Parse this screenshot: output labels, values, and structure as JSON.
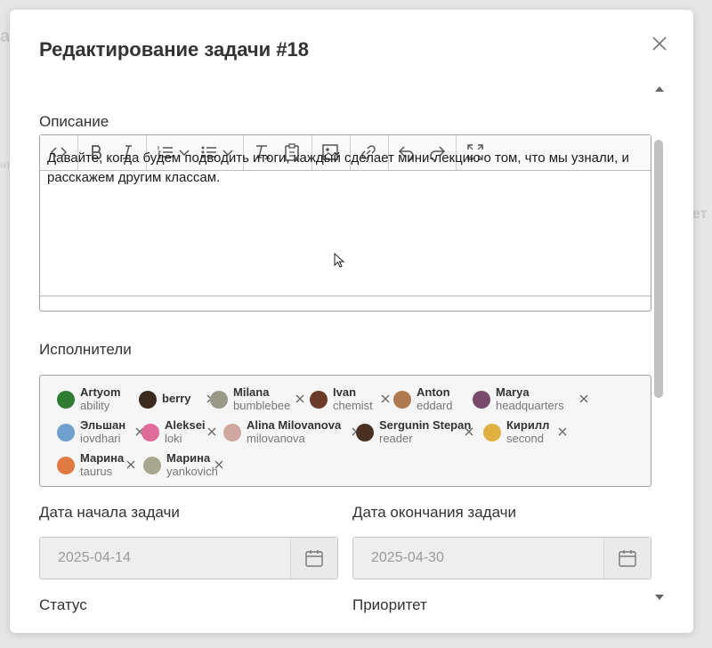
{
  "modal": {
    "title": "Редактирование задачи #18"
  },
  "background": {
    "hint1": "al",
    "hint2": "ет",
    "hint3": "нт"
  },
  "description": {
    "label": "Описание",
    "text": "Давайте, когда будем подводить итоги, каждый сделает мини-лекцию о том, что мы узнали, и расскажем другим классам."
  },
  "toolbar": {
    "icons": [
      "code-icon",
      "bold-icon",
      "italic-icon",
      "ordered-list-icon",
      "bullet-list-icon",
      "clear-format-icon",
      "paste-icon",
      "image-icon",
      "link-icon",
      "undo-icon",
      "redo-icon",
      "fullscreen-icon"
    ]
  },
  "assignees": {
    "label": "Исполнители",
    "items": [
      {
        "name": "Artyom",
        "username": "ability",
        "color": "#2e7d32"
      },
      {
        "name": "berry",
        "username": "",
        "color": "#3a2a20"
      },
      {
        "name": "Milana",
        "username": "bumblebee",
        "color": "#9a9a8a"
      },
      {
        "name": "Ivan",
        "username": "chemist",
        "color": "#6b3b2a"
      },
      {
        "name": "Anton",
        "username": "eddard",
        "color": "#b07a50"
      },
      {
        "name": "Marya",
        "username": "headquarters",
        "color": "#7a4a6a"
      },
      {
        "name": "Эльшан",
        "username": "iovdhari",
        "color": "#6fa0d0"
      },
      {
        "name": "Aleksei",
        "username": "loki",
        "color": "#e06a9a"
      },
      {
        "name": "Alina Milovanova",
        "username": "milovanova",
        "color": "#d0a8a0"
      },
      {
        "name": "Sergunin Stepan",
        "username": "reader",
        "color": "#4a3020"
      },
      {
        "name": "Кирилл",
        "username": "second",
        "color": "#e0b040"
      },
      {
        "name": "Марина",
        "username": "taurus",
        "color": "#e07a40"
      },
      {
        "name": "Марина",
        "username": "yankovich",
        "color": "#a8a890"
      }
    ]
  },
  "dates": {
    "start_label": "Дата начала задачи",
    "start_value": "2025-04-14",
    "end_label": "Дата окончания задачи",
    "end_value": "2025-04-30"
  },
  "status": {
    "label": "Статус"
  },
  "priority": {
    "label": "Приоритет"
  }
}
